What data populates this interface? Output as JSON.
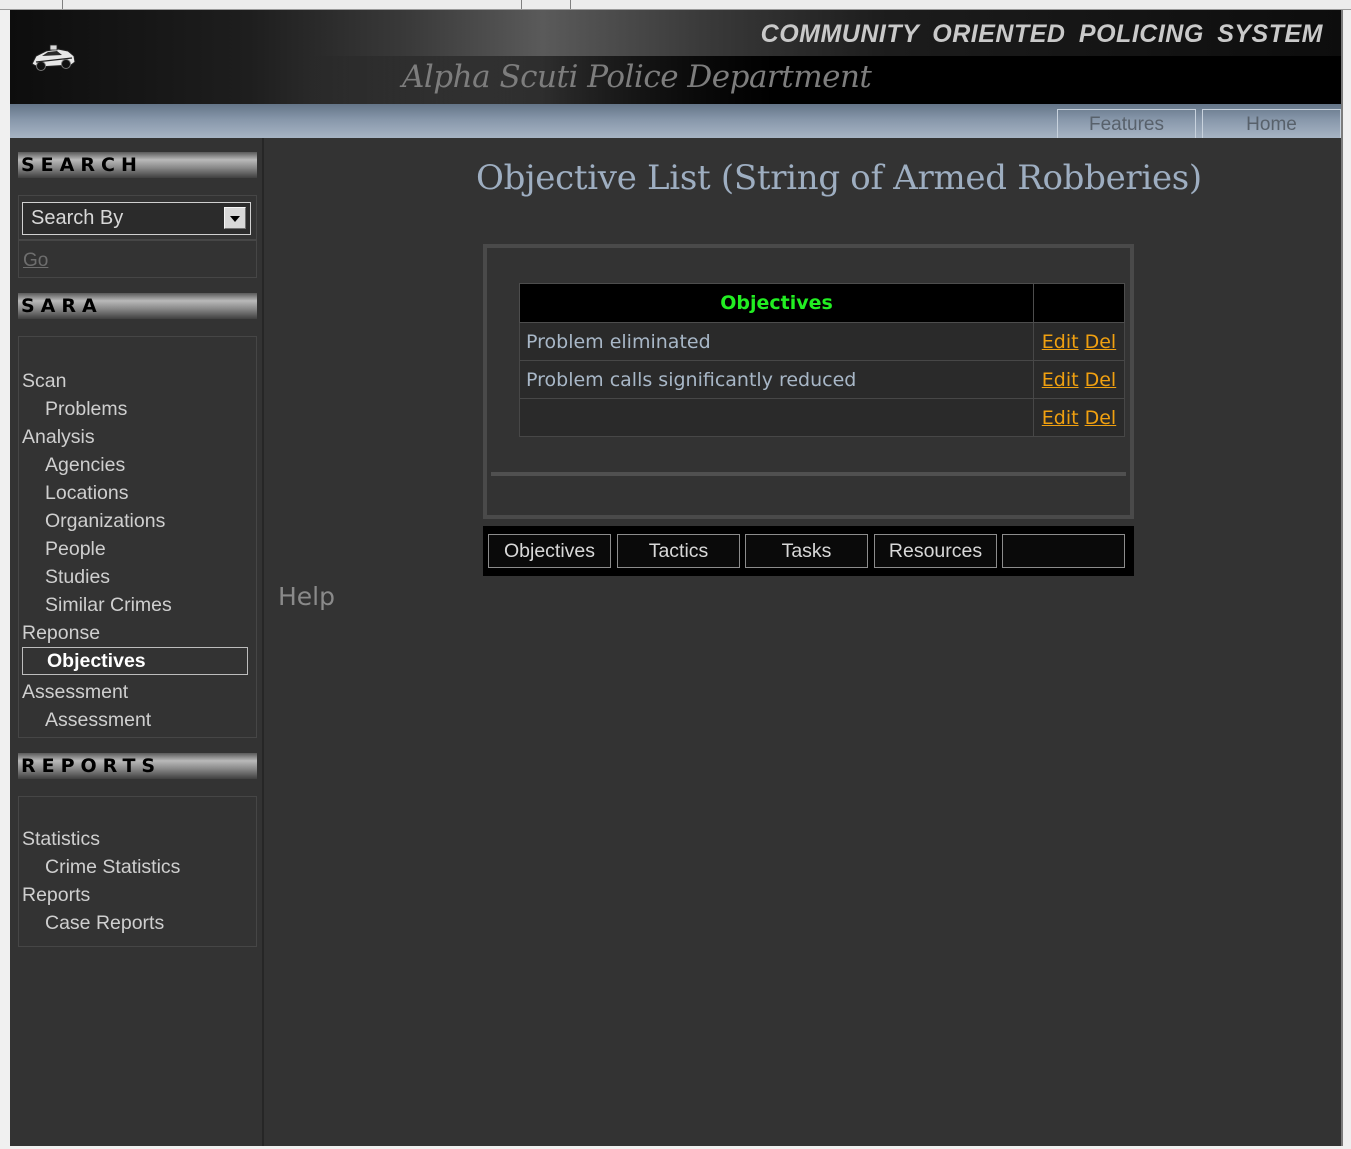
{
  "header": {
    "system_title": "COMMUNITY ORIENTED POLICING SYSTEM",
    "department": "Alpha Scuti Police Department",
    "logo_icon": "police-car-icon"
  },
  "nav": {
    "features": "Features",
    "home": "Home"
  },
  "sidebar": {
    "search": {
      "heading": "SEARCH",
      "select_value": "Search By",
      "go": "Go"
    },
    "sara": {
      "heading": "SARA",
      "items": [
        {
          "label": "Scan",
          "level": "top"
        },
        {
          "label": "Problems",
          "level": "sub"
        },
        {
          "label": "Analysis",
          "level": "top"
        },
        {
          "label": "Agencies",
          "level": "sub"
        },
        {
          "label": "Locations",
          "level": "sub"
        },
        {
          "label": "Organizations",
          "level": "sub"
        },
        {
          "label": "People",
          "level": "sub"
        },
        {
          "label": "Studies",
          "level": "sub"
        },
        {
          "label": "Similar Crimes",
          "level": "sub"
        },
        {
          "label": "Reponse",
          "level": "top"
        },
        {
          "label": "Objectives",
          "level": "sub",
          "active": true
        },
        {
          "label": "Assessment",
          "level": "top"
        },
        {
          "label": "Assessment",
          "level": "sub"
        }
      ]
    },
    "reports": {
      "heading": "REPORTS",
      "items": [
        {
          "label": "Statistics",
          "level": "top"
        },
        {
          "label": "Crime Statistics",
          "level": "sub"
        },
        {
          "label": "Reports",
          "level": "top"
        },
        {
          "label": "Case Reports",
          "level": "sub"
        }
      ]
    }
  },
  "help": "Help",
  "main": {
    "title": "Objective List (String of Armed Robberies)",
    "table": {
      "header": "Objectives",
      "rows": [
        {
          "objective": "Problem eliminated",
          "edit": "Edit",
          "del": "Del"
        },
        {
          "objective": "Problem calls significantly reduced",
          "edit": "Edit",
          "del": "Del"
        },
        {
          "objective": "",
          "edit": "Edit",
          "del": "Del"
        }
      ]
    },
    "tabs": [
      "Objectives",
      "Tactics",
      "Tasks",
      "Resources",
      ""
    ]
  },
  "colors": {
    "background": "#333333",
    "header_green": "#22ee22",
    "link_orange": "#f0a010",
    "title_blue": "#9eaec1"
  }
}
